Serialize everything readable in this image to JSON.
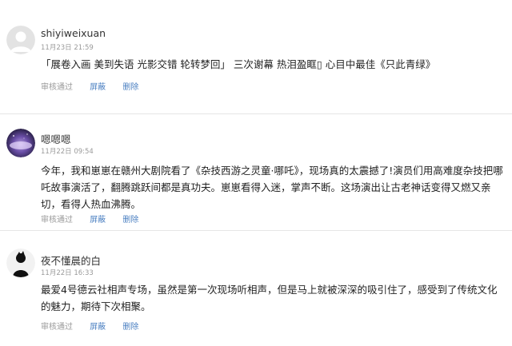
{
  "comments": [
    {
      "username": "shiyiweixuan",
      "timestamp": "11月23日 21:59",
      "avatar": "default-user-avatar",
      "content": "「展卷入画 美到失语 光影交错 轮转梦回」 三次谢幕 热泪盈眶▯ 心目中最佳《只此青绿》",
      "actions": {
        "status": "审核通过",
        "block": "屏蔽",
        "delete": "删除"
      }
    },
    {
      "username": "嗯嗯嗯",
      "timestamp": "11月22日 09:54",
      "avatar": "night-sky-avatar",
      "content": "今年，我和崽崽在赣州大剧院看了《杂技西游之灵童·哪吒》，现场真的太震撼了!演员们用高难度杂技把哪吒故事演活了，翻腾跳跃间都是真功夫。崽崽看得入迷，掌声不断。这场演出让古老神话变得又燃又亲切，看得人热血沸腾。",
      "actions": {
        "status": "审核通过",
        "block": "屏蔽",
        "delete": "删除"
      }
    },
    {
      "username": "夜不懂晨的白",
      "timestamp": "11月22日 16:33",
      "avatar": "silhouette-avatar",
      "content": "最爱4号德云社相声专场，虽然是第一次现场听相声，但是马上就被深深的吸引住了，感受到了传统文化的魅力，期待下次相聚。",
      "actions": {
        "status": "审核通过",
        "block": "屏蔽",
        "delete": "删除"
      }
    }
  ],
  "colors": {
    "link": "#4a7fc1",
    "muted": "#9a9a9a",
    "text": "#222222",
    "divider": "#e6e6e6"
  }
}
